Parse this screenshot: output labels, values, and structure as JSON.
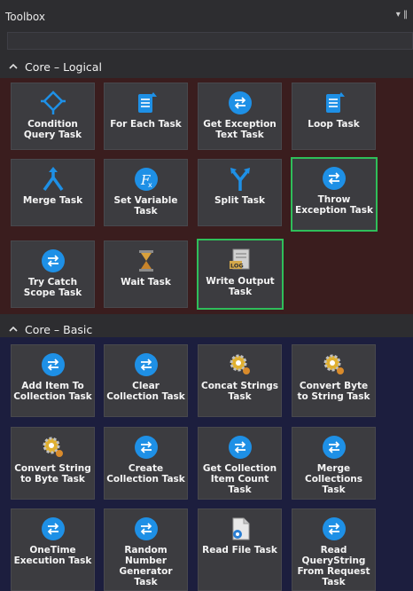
{
  "window": {
    "title": "Toolbox"
  },
  "colors": {
    "accent_selected": "#2fbe5a",
    "icon_blue": "#1e90e6"
  },
  "sections": [
    {
      "label": "Core – Logical",
      "items": [
        {
          "label": "Condition Query Task",
          "icon": "condition-icon"
        },
        {
          "label": "For Each Task",
          "icon": "foreach-icon"
        },
        {
          "label": "Get Exception Text Task",
          "icon": "exchange-icon"
        },
        {
          "label": "Loop Task",
          "icon": "loop-icon"
        },
        {
          "label": "Merge Task",
          "icon": "merge-icon"
        },
        {
          "label": "Set Variable Task",
          "icon": "variable-icon"
        },
        {
          "label": "Split Task",
          "icon": "split-icon"
        },
        {
          "label": "Throw Exception Task",
          "icon": "exchange-icon"
        },
        {
          "label": "Try Catch Scope Task",
          "icon": "exchange-icon"
        },
        {
          "label": "Wait Task",
          "icon": "hourglass-icon"
        },
        {
          "label": "Write Output Task",
          "icon": "log-icon"
        }
      ]
    },
    {
      "label": "Core – Basic",
      "items": [
        {
          "label": "Add Item To Collection Task",
          "icon": "exchange-icon"
        },
        {
          "label": "Clear Collection Task",
          "icon": "exchange-icon"
        },
        {
          "label": "Concat Strings Task",
          "icon": "gear-icon"
        },
        {
          "label": "Convert Byte to String Task",
          "icon": "gear-icon"
        },
        {
          "label": "Convert String to Byte Task",
          "icon": "gear-icon"
        },
        {
          "label": "Create Collection Task",
          "icon": "exchange-icon"
        },
        {
          "label": "Get Collection Item Count Task",
          "icon": "exchange-icon"
        },
        {
          "label": "Merge Collections Task",
          "icon": "exchange-icon"
        },
        {
          "label": "OneTime Execution Task",
          "icon": "exchange-icon"
        },
        {
          "label": "Random Number Generator Task",
          "icon": "exchange-icon"
        },
        {
          "label": "Read File Task",
          "icon": "file-icon"
        },
        {
          "label": "Read QueryString From Request Task",
          "icon": "exchange-icon"
        }
      ]
    }
  ]
}
